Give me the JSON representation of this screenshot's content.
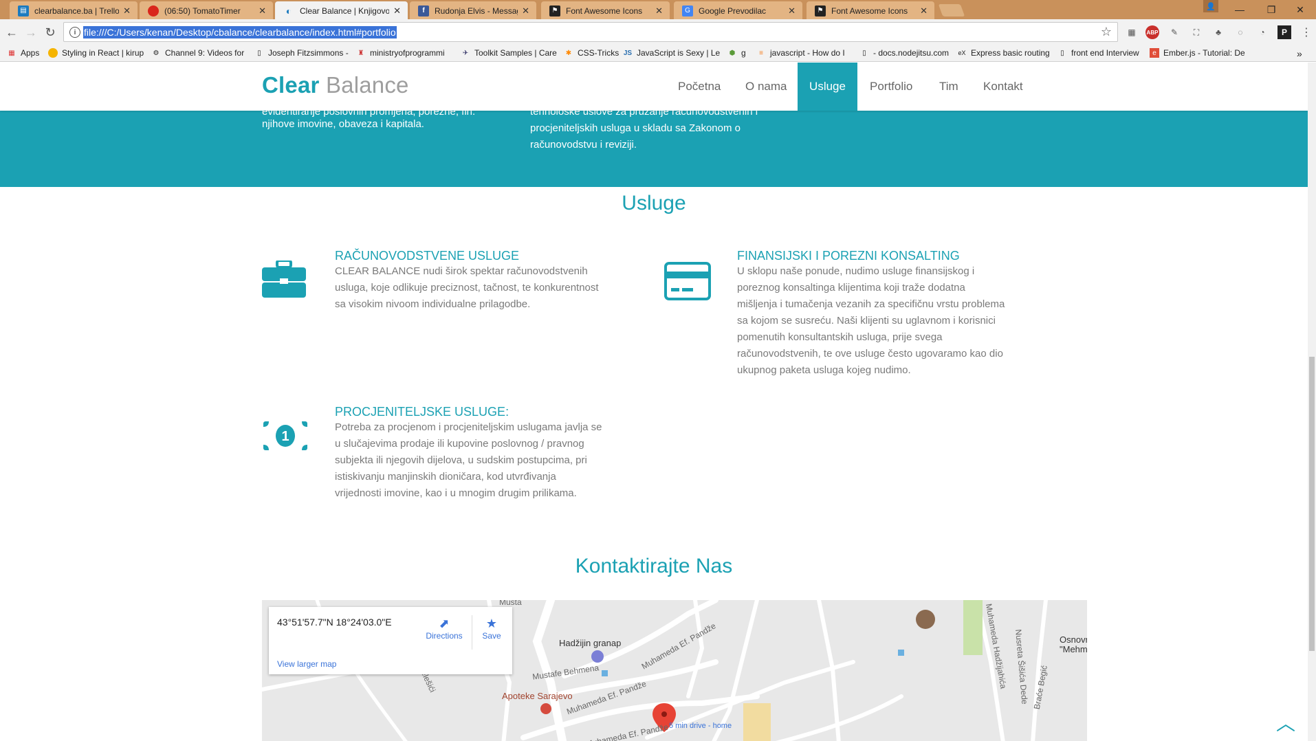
{
  "browser": {
    "tabs": [
      {
        "label": "clearbalance.ba | Trello",
        "icon": "trello-icon",
        "color": "#1d7bbf"
      },
      {
        "label": "(06:50) TomatoTimer",
        "icon": "tomato-icon",
        "color": "#d9261c"
      },
      {
        "label": "Clear Balance | Knjigovod",
        "icon": "clearbalance-icon",
        "color": "#1d7bbf"
      },
      {
        "label": "Rudonja Elvis - Message",
        "icon": "facebook-icon",
        "color": "#3b5998"
      },
      {
        "label": "Font Awesome Icons",
        "icon": "flag-icon",
        "color": "#222222"
      },
      {
        "label": "Google Prevodilac",
        "icon": "translate-icon",
        "color": "#4285f4"
      },
      {
        "label": "Font Awesome Icons",
        "icon": "flag-icon",
        "color": "#222222"
      }
    ],
    "url": "file:///C:/Users/kenan/Desktop/cbalance/clearbalance/index.html#portfolio",
    "bookmarks": [
      "Apps",
      "Styling in React | kirup",
      "Channel 9: Videos for",
      "Joseph Fitzsimmons -",
      "ministryofprogrammi",
      "Toolkit Samples | Care",
      "CSS-Tricks",
      "JavaScript is Sexy | Le",
      "g",
      "javascript - How do I",
      "- docs.nodejitsu.com",
      "Express basic routing",
      "front end Interview",
      "Ember.js - Tutorial: De"
    ]
  },
  "site": {
    "logo_bold": "Clear",
    "logo_thin": "Balance",
    "nav": [
      "Početna",
      "O nama",
      "Usluge",
      "Portfolio",
      "Tim",
      "Kontakt"
    ],
    "active_nav": "Usluge",
    "teal_col1_cut": "evidentiranje poslovnih promjena, porezne, fin.",
    "teal_col1": "njihove imovine, obaveza i kapitala.",
    "teal_col2_cut": "tehnološke uslove za pružanje računovodstvenih i",
    "teal_col2_a": "procjeniteljskih usluga u skladu sa Zakonom o",
    "teal_col2_b": "računovodstvu i reviziji.",
    "services_title": "Usluge",
    "services": [
      {
        "title": "RAČUNOVODSTVENE USLUGE",
        "icon": "briefcase-icon",
        "lines": [
          "CLEAR BALANCE nudi širok spektar računovodstvenih",
          "usluga, koje odlikuje preciznost, tačnost, te konkurentnost",
          "sa visokim nivoom individualne prilagodbe."
        ]
      },
      {
        "title": "FINANSIJSKI I POREZNI KONSALTING",
        "icon": "credit-card-icon",
        "lines": [
          "U sklopu naše ponude, nudimo usluge finansijskog i",
          "poreznog konsaltinga klijentima koji traže dodatna",
          "mišljenja i tumačenja vezanih za specifičnu vrstu problema",
          "sa kojom se susreću. Naši klijenti su uglavnom i korisnici",
          "pomenutih konsultantskih usluga, prije svega",
          "računovodstvenih, te ove usluge često ugovaramo kao dio",
          "ukupnog paketa usluga kojeg nudimo."
        ]
      },
      {
        "title": "PROCJENITELJSKE USLUGE:",
        "icon": "money-icon",
        "lines": [
          "Potreba za procjenom i procjeniteljskim uslugama javlja se",
          "u slučajevima prodaje ili kupovine poslovnog / pravnog",
          "subjekta ili njegovih dijelova, u sudskim postupcima, pri",
          "istiskivanju manjinskih dioničara, kod utvrđivanja",
          "vrijednosti imovine, kao i u mnogim drugim prilikama."
        ]
      }
    ],
    "contact_title": "Kontaktirajte Nas",
    "map": {
      "coords": "43°51'57.7\"N 18°24'03.0\"E",
      "directions": "Directions",
      "save": "Save",
      "view_larger": "View larger map",
      "places": {
        "hadzijin": "Hadžijin granap",
        "apoteke": "Apoteke Sarajevo",
        "drive": "5 min drive - home",
        "osnovna_a": "Osnovn",
        "osnovna_b": "\"Mehme"
      },
      "streets": {
        "mustafe": "Mustafe Behmena",
        "muhameda1": "Muhameda Ef. Pandže",
        "muhameda2": "Muhameda Ef. Pandže",
        "muhameda3": "Muhameda Ef. Pandže",
        "velesici": "Velešići",
        "hadzijahica": "Muhameda Hadžijahića",
        "sasica": "Nusreta Šišića Dede",
        "brace": "Braće Begić",
        "musta": "Musta"
      }
    }
  }
}
